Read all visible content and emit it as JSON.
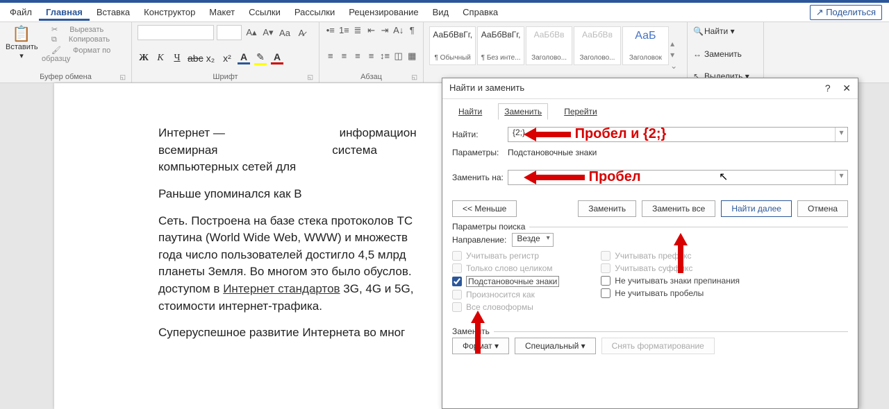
{
  "menu": {
    "items": [
      "Файл",
      "Главная",
      "Вставка",
      "Конструктор",
      "Макет",
      "Ссылки",
      "Рассылки",
      "Рецензирование",
      "Вид",
      "Справка"
    ],
    "active_index": 1,
    "share": "Поделиться"
  },
  "ribbon": {
    "clipboard": {
      "paste": "Вставить",
      "cut": "Вырезать",
      "copy": "Копировать",
      "fmt": "Формат по образцу",
      "label": "Буфер обмена"
    },
    "font": {
      "label": "Шрифт"
    },
    "para": {
      "label": "Абзац"
    },
    "styles": {
      "items": [
        {
          "preview": "АаБбВвГг,",
          "name": "¶ Обычный"
        },
        {
          "preview": "АаБбВвГг,",
          "name": "¶ Без инте..."
        },
        {
          "preview": "АаБбВв",
          "name": "Заголово..."
        },
        {
          "preview": "АаБбВв",
          "name": "Заголово..."
        },
        {
          "preview": "АаБ",
          "name": "Заголовок"
        }
      ]
    },
    "editing": {
      "find": "Найти",
      "replace": "Заменить",
      "select": "Выделить"
    }
  },
  "document": {
    "p1a": "Интернет —",
    "p1b": "информацион",
    "p1c": "всемирная",
    "p1d": "система",
    "p1e": "компьютерных сетей для",
    "p2": "Раньше упоминался как                                    В",
    "p3a": "Сеть. Построена на базе стека протоколов TC",
    "p3b": "паутина (World Wide Web, WWW) и множеств",
    "p3c": "года число пользователей достигло 4,5 млрд",
    "p3d": "планеты Земля. Во многом это было обуслов.",
    "p3e_before": "доступом в ",
    "p3e_link": "Интернет стандартов",
    "p3e_after": " 3G, 4G и 5G,",
    "p3f": "стоимости интернет-трафика.",
    "p4": "Суперуспешное развитие Интернета во мног"
  },
  "dialog": {
    "title": "Найти и заменить",
    "tabs": {
      "find": "Найти",
      "replace": "Заменить",
      "goto": "Перейти"
    },
    "find_label": "Найти:",
    "find_value": "{2;}",
    "params_label": "Параметры:",
    "params_value": "Подстановочные знаки",
    "replace_label": "Заменить на:",
    "replace_value": "",
    "btn_less": "<< Меньше",
    "btn_replace": "Заменить",
    "btn_replace_all": "Заменить все",
    "btn_find_next": "Найти далее",
    "btn_cancel": "Отмена",
    "search_params": "Параметры поиска",
    "direction_label": "Направление:",
    "direction_value": "Везде",
    "opts_left": {
      "case": "Учитывать регистр",
      "whole": "Только слово целиком",
      "wildcards": "Подстановочные знаки",
      "sounds": "Произносится как",
      "forms": "Все словоформы"
    },
    "opts_right": {
      "prefix": "Учитывать префикс",
      "suffix": "Учитывать суффикс",
      "punct": "Не учитывать знаки препинания",
      "spaces": "Не учитывать пробелы"
    },
    "replace_section": "Заменить",
    "btn_format": "Формат ▾",
    "btn_special": "Специальный ▾",
    "btn_nofmt": "Снять форматирование"
  },
  "annotations": {
    "a1": "Пробел и {2;}",
    "a2": "Пробел"
  }
}
